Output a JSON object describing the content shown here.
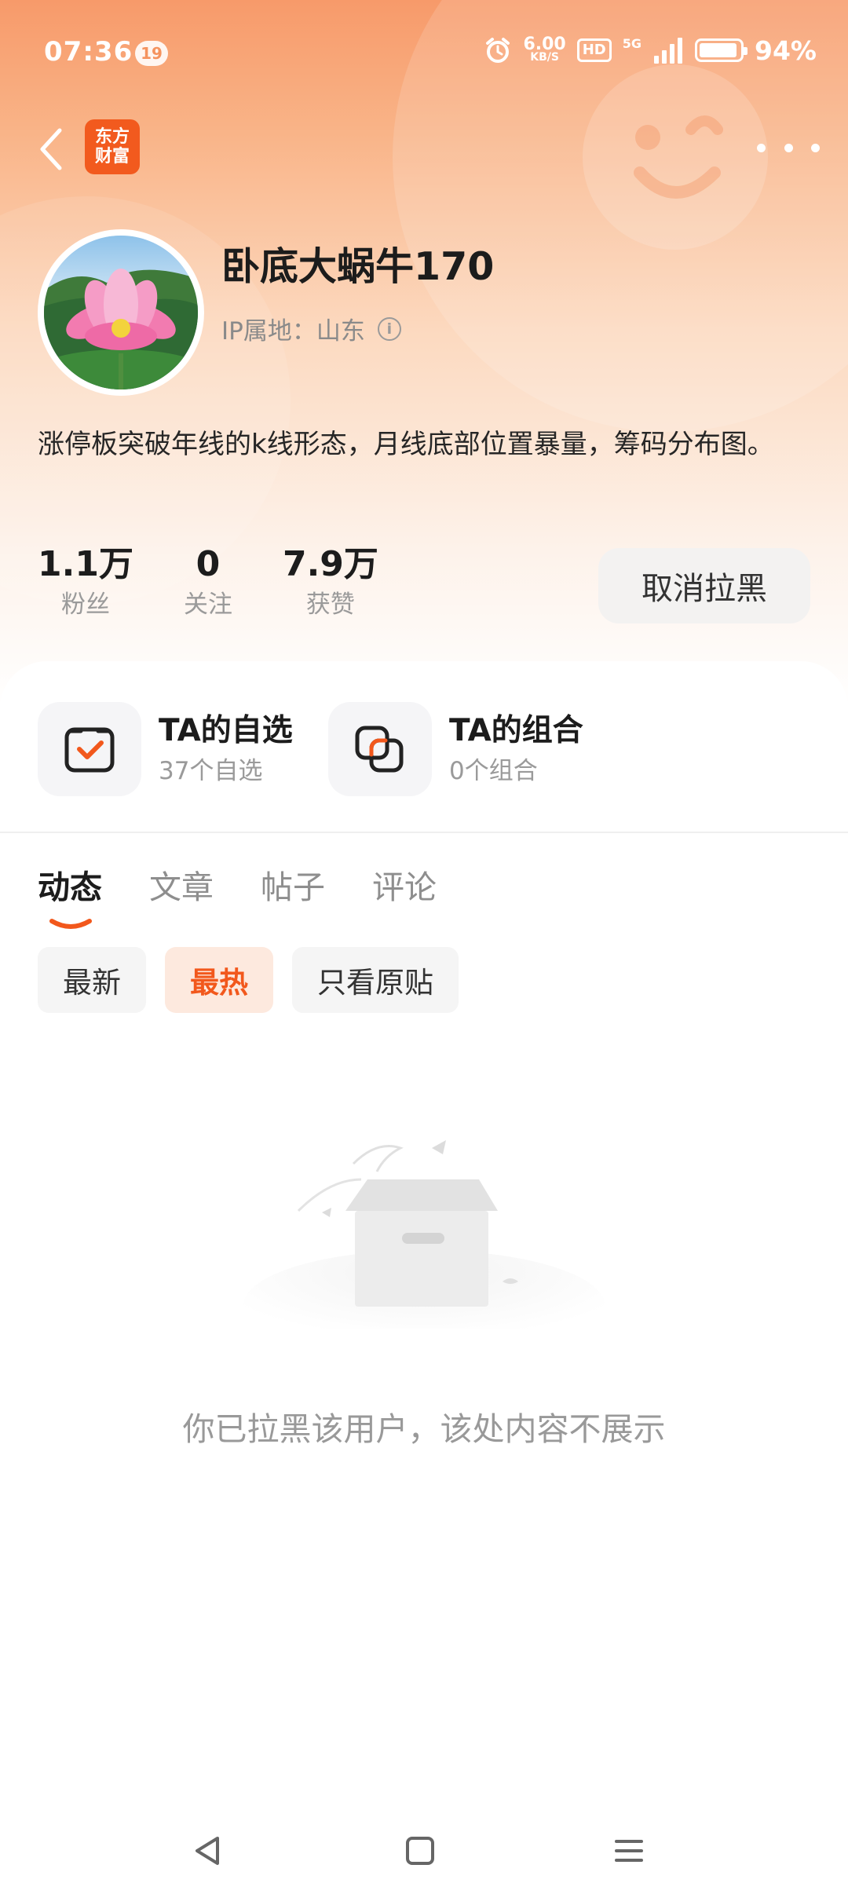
{
  "status_bar": {
    "time": "07:36",
    "notification_count": "19",
    "net_speed": "6.00",
    "net_unit": "KB/S",
    "hd_label": "HD",
    "signal_label": "5G",
    "battery_level": 0.94,
    "battery_percent": "94%",
    "icons": [
      "alarm-icon",
      "hd-icon",
      "signal-icon",
      "battery-icon"
    ]
  },
  "nav": {
    "logo_line1": "东方",
    "logo_line2": "财富",
    "back_icon": "back-arrow-icon",
    "more_icon": "more-dots-icon"
  },
  "profile": {
    "username": "卧底大蜗牛170",
    "ip_location": "IP属地：山东",
    "bio": "涨停板突破年线的k线形态，月线底部位置暴量，筹码分布图。",
    "stats": [
      {
        "value": "1.1万",
        "label": "粉丝"
      },
      {
        "value": "0",
        "label": "关注"
      },
      {
        "value": "7.9万",
        "label": "获赞"
      }
    ],
    "unblock_label": "取消拉黑"
  },
  "quick_links": [
    {
      "title": "TA的自选",
      "subtitle": "37个自选",
      "icon": "watchlist-check-icon"
    },
    {
      "title": "TA的组合",
      "subtitle": "0个组合",
      "icon": "portfolio-icon"
    }
  ],
  "tabs": [
    {
      "label": "动态",
      "active": true
    },
    {
      "label": "文章",
      "active": false
    },
    {
      "label": "帖子",
      "active": false
    },
    {
      "label": "评论",
      "active": false
    }
  ],
  "filters": [
    {
      "label": "最新",
      "active": false
    },
    {
      "label": "最热",
      "active": true
    },
    {
      "label": "只看原贴",
      "active": false
    }
  ],
  "empty_state": {
    "message": "你已拉黑该用户，该处内容不展示",
    "icon": "empty-box-icon"
  },
  "colors": {
    "accent": "#f2581c",
    "header_gradient_top": "#f79a6a",
    "header_gradient_bottom": "#ffffff"
  }
}
